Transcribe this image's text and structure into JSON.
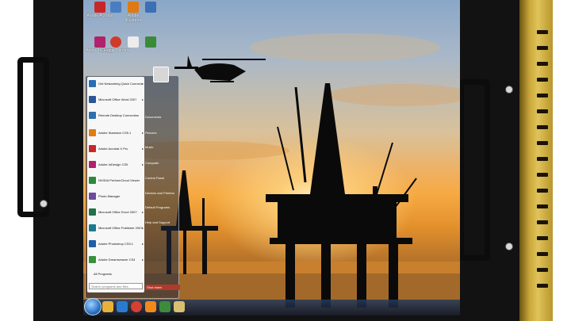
{
  "desktop_icons": [
    {
      "name": "acrobat-icon",
      "label": "Adobe Acrobat",
      "color": "#c62828"
    },
    {
      "name": "apps-icon",
      "label": "",
      "color": "#4a7ec0"
    },
    {
      "name": "illustrator-icon",
      "label": "Adobe Illustrator",
      "color": "#e07a10"
    },
    {
      "name": "doc-icon",
      "label": "",
      "color": "#3d6fb5"
    },
    {
      "name": "indesign-icon",
      "label": "Adobe InDesign",
      "color": "#b0236b"
    },
    {
      "name": "chrome-icon",
      "label": "Google Chrome",
      "color": "#d03a2a"
    },
    {
      "name": "file-icon",
      "label": "",
      "color": "#ececec"
    },
    {
      "name": "sheet-icon",
      "label": "",
      "color": "#3a8a3a"
    }
  ],
  "start_menu": {
    "programs": [
      {
        "label": "Get Networking Quick Connect",
        "color": "#2a6db5",
        "arrow": true
      },
      {
        "label": "Microsoft Office Word 2007",
        "color": "#2b579a",
        "arrow": true
      },
      {
        "label": "Remote Desktop Connection",
        "color": "#2f6fb0",
        "arrow": false
      },
      {
        "label": "Adobe Illustrator CS5.1",
        "color": "#e27c12",
        "arrow": true
      },
      {
        "label": "Adobe Acrobat X Pro",
        "color": "#c62828",
        "arrow": true
      },
      {
        "label": "Adobe InDesign CS5",
        "color": "#b0236b",
        "arrow": true
      },
      {
        "label": "NVIDIA PerformCloud Viewer",
        "color": "#2a8a3a",
        "arrow": false
      },
      {
        "label": "Photo Manager",
        "color": "#6b4aa0",
        "arrow": false
      },
      {
        "label": "Microsoft Office Excel 2007",
        "color": "#217346",
        "arrow": true
      },
      {
        "label": "Microsoft Office Publisher 2007",
        "color": "#1b7a8c",
        "arrow": true
      },
      {
        "label": "Adobe Photoshop CS5.1",
        "color": "#1f5ea8",
        "arrow": true
      },
      {
        "label": "Adobe Dreamweaver CS4",
        "color": "#3a8f3a",
        "arrow": true
      }
    ],
    "all_programs": "All Programs",
    "search_placeholder": "Search programs and files",
    "right_items": [
      "Documents",
      "Pictures",
      "Music",
      "Computer",
      "Control Panel",
      "Devices and Printers",
      "Default Programs",
      "Help and Support"
    ],
    "shutdown": "Shut down"
  },
  "taskbar": {
    "icons": [
      {
        "name": "explorer-icon",
        "color": "#e8b23a"
      },
      {
        "name": "ie-icon",
        "color": "#2a7bd0"
      },
      {
        "name": "chrome-taskbar-icon",
        "color": "#d64030"
      },
      {
        "name": "mediaplayer-icon",
        "color": "#f08a1a"
      },
      {
        "name": "app-taskbar-icon",
        "color": "#3c8c3c"
      },
      {
        "name": "folder-taskbar-icon",
        "color": "#d8c070"
      },
      {
        "name": "tool-taskbar-icon",
        "color": "#8a4ab0"
      }
    ]
  },
  "colors": {
    "chassis": "#121212",
    "gold": "#c9a73a",
    "sky": "#f0b060"
  }
}
